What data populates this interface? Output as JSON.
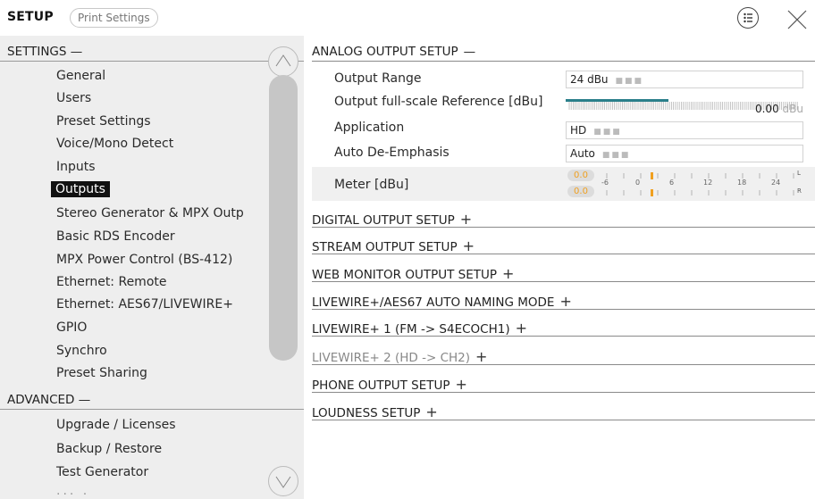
{
  "header": {
    "title": "SETUP",
    "tab": "Print Settings"
  },
  "sidebar": {
    "settings_header": "SETTINGS —",
    "items": [
      "General",
      "Users",
      "Preset Settings",
      "Voice/Mono Detect",
      "Inputs",
      "Outputs",
      "Stereo Generator & MPX Outp",
      "Basic RDS Encoder",
      "MPX Power Control (BS-412)",
      "Ethernet: Remote",
      "Ethernet: AES67/LIVEWIRE+",
      "GPIO",
      "Synchro",
      "Preset Sharing"
    ],
    "selected": "Outputs",
    "advanced_header": "ADVANCED —",
    "advanced_items": [
      "Upgrade / Licenses",
      "Backup / Restore",
      "Test Generator"
    ]
  },
  "analog": {
    "title": "ANALOG OUTPUT SETUP",
    "output_range_label": "Output Range",
    "output_range_value": "24 dBu",
    "fullscale_label": "Output full-scale Reference [dBu]",
    "fullscale_value": "0.00",
    "fullscale_unit": "dBu",
    "fullscale_fill": 0.5,
    "application_label": "Application",
    "application_value": "HD",
    "deemphasis_label": "Auto De-Emphasis",
    "deemphasis_value": "Auto",
    "meter_label": "Meter [dBu]",
    "meter_left": "0.0",
    "meter_right": "0.0",
    "meter_scale": [
      "-6",
      "0",
      "6",
      "12",
      "18",
      "24"
    ],
    "meter_L": "L",
    "meter_R": "R"
  },
  "sections": [
    {
      "label": "DIGITAL OUTPUT SETUP",
      "dim": false
    },
    {
      "label": "STREAM OUTPUT SETUP",
      "dim": false
    },
    {
      "label": "WEB MONITOR OUTPUT SETUP",
      "dim": false
    },
    {
      "label": "LIVEWIRE+/AES67 AUTO NAMING MODE",
      "dim": false
    },
    {
      "label": "LIVEWIRE+ 1 (FM -> S4ECOCH1)",
      "dim": false
    },
    {
      "label": "LIVEWIRE+ 2 (HD -> CH2)",
      "dim": true
    },
    {
      "label": "PHONE OUTPUT SETUP",
      "dim": false
    },
    {
      "label": "LOUDNESS SETUP",
      "dim": false
    }
  ],
  "colors": {
    "sidebar_bg": "#eeeeee",
    "accent_teal": "#2a7f8a",
    "meter_orange": "#f0a020"
  }
}
